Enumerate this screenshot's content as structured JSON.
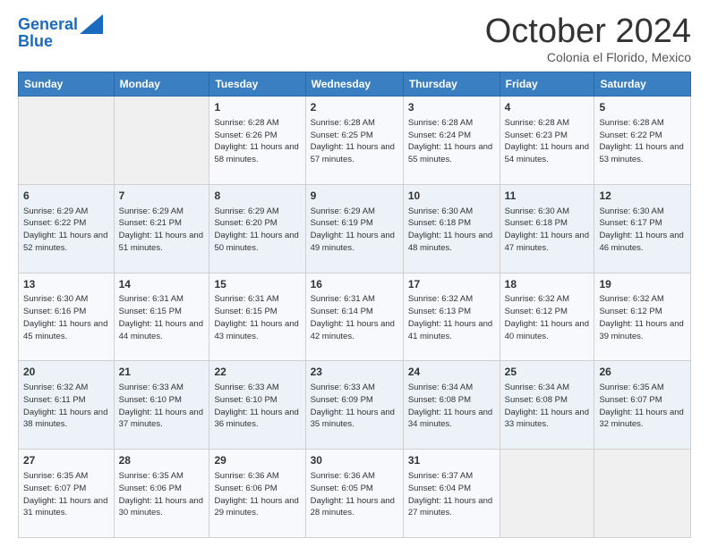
{
  "logo": {
    "line1": "General",
    "line2": "Blue"
  },
  "title": "October 2024",
  "location": "Colonia el Florido, Mexico",
  "days_of_week": [
    "Sunday",
    "Monday",
    "Tuesday",
    "Wednesday",
    "Thursday",
    "Friday",
    "Saturday"
  ],
  "weeks": [
    [
      {
        "day": "",
        "info": ""
      },
      {
        "day": "",
        "info": ""
      },
      {
        "day": "1",
        "sunrise": "6:28 AM",
        "sunset": "6:26 PM",
        "daylight": "11 hours and 58 minutes."
      },
      {
        "day": "2",
        "sunrise": "6:28 AM",
        "sunset": "6:25 PM",
        "daylight": "11 hours and 57 minutes."
      },
      {
        "day": "3",
        "sunrise": "6:28 AM",
        "sunset": "6:24 PM",
        "daylight": "11 hours and 55 minutes."
      },
      {
        "day": "4",
        "sunrise": "6:28 AM",
        "sunset": "6:23 PM",
        "daylight": "11 hours and 54 minutes."
      },
      {
        "day": "5",
        "sunrise": "6:28 AM",
        "sunset": "6:22 PM",
        "daylight": "11 hours and 53 minutes."
      }
    ],
    [
      {
        "day": "6",
        "sunrise": "6:29 AM",
        "sunset": "6:22 PM",
        "daylight": "11 hours and 52 minutes."
      },
      {
        "day": "7",
        "sunrise": "6:29 AM",
        "sunset": "6:21 PM",
        "daylight": "11 hours and 51 minutes."
      },
      {
        "day": "8",
        "sunrise": "6:29 AM",
        "sunset": "6:20 PM",
        "daylight": "11 hours and 50 minutes."
      },
      {
        "day": "9",
        "sunrise": "6:29 AM",
        "sunset": "6:19 PM",
        "daylight": "11 hours and 49 minutes."
      },
      {
        "day": "10",
        "sunrise": "6:30 AM",
        "sunset": "6:18 PM",
        "daylight": "11 hours and 48 minutes."
      },
      {
        "day": "11",
        "sunrise": "6:30 AM",
        "sunset": "6:18 PM",
        "daylight": "11 hours and 47 minutes."
      },
      {
        "day": "12",
        "sunrise": "6:30 AM",
        "sunset": "6:17 PM",
        "daylight": "11 hours and 46 minutes."
      }
    ],
    [
      {
        "day": "13",
        "sunrise": "6:30 AM",
        "sunset": "6:16 PM",
        "daylight": "11 hours and 45 minutes."
      },
      {
        "day": "14",
        "sunrise": "6:31 AM",
        "sunset": "6:15 PM",
        "daylight": "11 hours and 44 minutes."
      },
      {
        "day": "15",
        "sunrise": "6:31 AM",
        "sunset": "6:15 PM",
        "daylight": "11 hours and 43 minutes."
      },
      {
        "day": "16",
        "sunrise": "6:31 AM",
        "sunset": "6:14 PM",
        "daylight": "11 hours and 42 minutes."
      },
      {
        "day": "17",
        "sunrise": "6:32 AM",
        "sunset": "6:13 PM",
        "daylight": "11 hours and 41 minutes."
      },
      {
        "day": "18",
        "sunrise": "6:32 AM",
        "sunset": "6:12 PM",
        "daylight": "11 hours and 40 minutes."
      },
      {
        "day": "19",
        "sunrise": "6:32 AM",
        "sunset": "6:12 PM",
        "daylight": "11 hours and 39 minutes."
      }
    ],
    [
      {
        "day": "20",
        "sunrise": "6:32 AM",
        "sunset": "6:11 PM",
        "daylight": "11 hours and 38 minutes."
      },
      {
        "day": "21",
        "sunrise": "6:33 AM",
        "sunset": "6:10 PM",
        "daylight": "11 hours and 37 minutes."
      },
      {
        "day": "22",
        "sunrise": "6:33 AM",
        "sunset": "6:10 PM",
        "daylight": "11 hours and 36 minutes."
      },
      {
        "day": "23",
        "sunrise": "6:33 AM",
        "sunset": "6:09 PM",
        "daylight": "11 hours and 35 minutes."
      },
      {
        "day": "24",
        "sunrise": "6:34 AM",
        "sunset": "6:08 PM",
        "daylight": "11 hours and 34 minutes."
      },
      {
        "day": "25",
        "sunrise": "6:34 AM",
        "sunset": "6:08 PM",
        "daylight": "11 hours and 33 minutes."
      },
      {
        "day": "26",
        "sunrise": "6:35 AM",
        "sunset": "6:07 PM",
        "daylight": "11 hours and 32 minutes."
      }
    ],
    [
      {
        "day": "27",
        "sunrise": "6:35 AM",
        "sunset": "6:07 PM",
        "daylight": "11 hours and 31 minutes."
      },
      {
        "day": "28",
        "sunrise": "6:35 AM",
        "sunset": "6:06 PM",
        "daylight": "11 hours and 30 minutes."
      },
      {
        "day": "29",
        "sunrise": "6:36 AM",
        "sunset": "6:06 PM",
        "daylight": "11 hours and 29 minutes."
      },
      {
        "day": "30",
        "sunrise": "6:36 AM",
        "sunset": "6:05 PM",
        "daylight": "11 hours and 28 minutes."
      },
      {
        "day": "31",
        "sunrise": "6:37 AM",
        "sunset": "6:04 PM",
        "daylight": "11 hours and 27 minutes."
      },
      {
        "day": "",
        "info": ""
      },
      {
        "day": "",
        "info": ""
      }
    ]
  ],
  "labels": {
    "sunrise_prefix": "Sunrise: ",
    "sunset_prefix": "Sunset: ",
    "daylight_prefix": "Daylight: "
  }
}
